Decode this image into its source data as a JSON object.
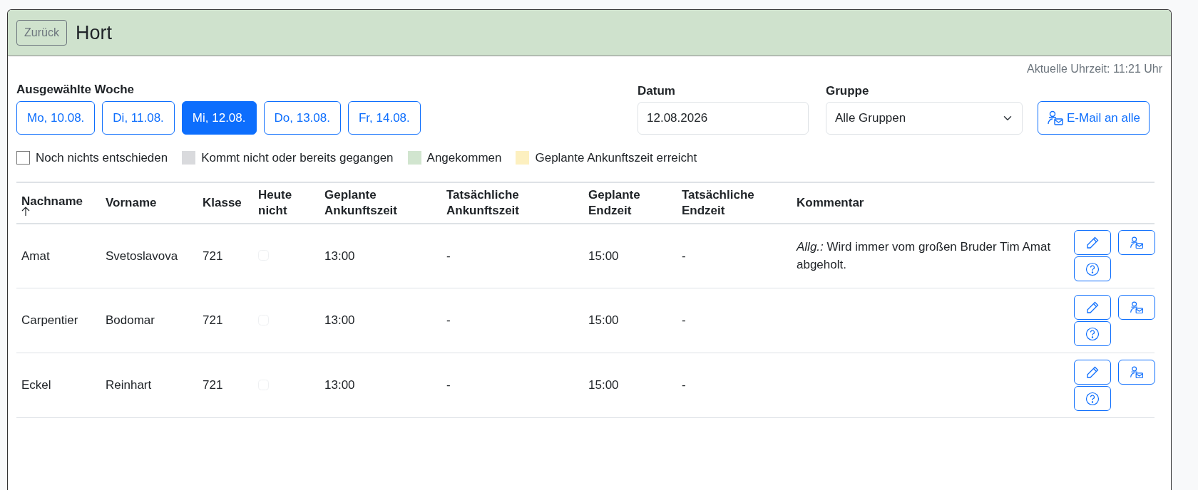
{
  "header": {
    "back_button": "Zurück",
    "title": "Hort"
  },
  "current_time": "Aktuelle Uhrzeit: 11:21 Uhr",
  "week": {
    "label": "Ausgewählte Woche",
    "days": [
      {
        "label": "Mo, 10.08.",
        "selected": false
      },
      {
        "label": "Di, 11.08.",
        "selected": false
      },
      {
        "label": "Mi, 12.08.",
        "selected": true
      },
      {
        "label": "Do, 13.08.",
        "selected": false
      },
      {
        "label": "Fr, 14.08.",
        "selected": false
      }
    ]
  },
  "date": {
    "label": "Datum",
    "value": "12.08.2026"
  },
  "group": {
    "label": "Gruppe",
    "value": "Alle Gruppen"
  },
  "email_all_button": "E-Mail an alle",
  "legend": [
    {
      "label": "Noch nichts entschieden",
      "color": "#ffffff"
    },
    {
      "label": "Kommt nicht oder bereits gegangen",
      "color": "#d9dadd"
    },
    {
      "label": "Angekommen",
      "color": "#d1e5cf"
    },
    {
      "label": "Geplante Ankunftszeit erreicht",
      "color": "#fdf0c0"
    }
  ],
  "table": {
    "columns": [
      {
        "label": "Nachname",
        "sorted": true
      },
      {
        "label": "Vorname",
        "sorted": false
      },
      {
        "label": "Klasse",
        "sorted": false
      },
      {
        "label": "Heute nicht",
        "sorted": false
      },
      {
        "label": "Geplante Ankunftszeit",
        "sorted": false
      },
      {
        "label": "Tatsächliche Ankunftszeit",
        "sorted": false
      },
      {
        "label": "Geplante Endzeit",
        "sorted": false
      },
      {
        "label": "Tatsächliche Endzeit",
        "sorted": false
      },
      {
        "label": "Kommentar",
        "sorted": false
      }
    ],
    "rows": [
      {
        "nachname": "Amat",
        "vorname": "Svetoslavova",
        "klasse": "721",
        "heute_nicht": false,
        "geplante_ankunft": "13:00",
        "tatsaechliche_ankunft": "-",
        "geplante_endzeit": "15:00",
        "tatsaechliche_endzeit": "-",
        "kommentar": "*Allg.:* Wird immer vom großen Bruder Tim Amat abgeholt."
      },
      {
        "nachname": "Carpentier",
        "vorname": "Bodomar",
        "klasse": "721",
        "heute_nicht": false,
        "geplante_ankunft": "13:00",
        "tatsaechliche_ankunft": "-",
        "geplante_endzeit": "15:00",
        "tatsaechliche_endzeit": "-"
      },
      {
        "nachname": "Eckel",
        "vorname": "Reinhart",
        "klasse": "721",
        "heute_nicht": false,
        "geplante_ankunft": "13:00",
        "tatsaechliche_ankunft": "-",
        "geplante_endzeit": "15:00",
        "tatsaechliche_endzeit": "-"
      }
    ]
  }
}
